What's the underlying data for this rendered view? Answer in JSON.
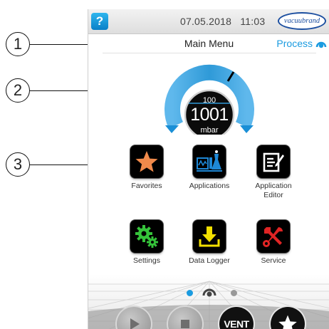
{
  "callouts": [
    "1",
    "2",
    "3"
  ],
  "header": {
    "help_label": "?",
    "date": "07.05.2018",
    "time": "11:03",
    "brand": "vacuubrand"
  },
  "menu": {
    "title": "Main Menu",
    "process_label": "Process"
  },
  "gauge": {
    "setpoint": "100",
    "pressure": "1001",
    "unit": "mbar"
  },
  "tiles": [
    {
      "label": "Favorites",
      "icon": "star-icon"
    },
    {
      "label": "Applications",
      "icon": "applications-icon"
    },
    {
      "label": "Application Editor",
      "icon": "edit-icon"
    },
    {
      "label": "Settings",
      "icon": "gears-icon"
    },
    {
      "label": "Data Logger",
      "icon": "download-icon"
    },
    {
      "label": "Service",
      "icon": "tools-icon"
    }
  ],
  "pager": {
    "pages": 3,
    "active": 1
  },
  "bottom": {
    "play_icon": "play-icon",
    "stop_icon": "stop-icon",
    "vent_label": "VENT",
    "favorite_icon": "star-icon"
  },
  "colors": {
    "accent": "#1a9be0",
    "gauge_arc": "#2f9ad8",
    "star": "#f08a4b",
    "applications": "#1e88d6",
    "settings": "#35c23a",
    "logger": "#f2e000",
    "service": "#e02424"
  }
}
